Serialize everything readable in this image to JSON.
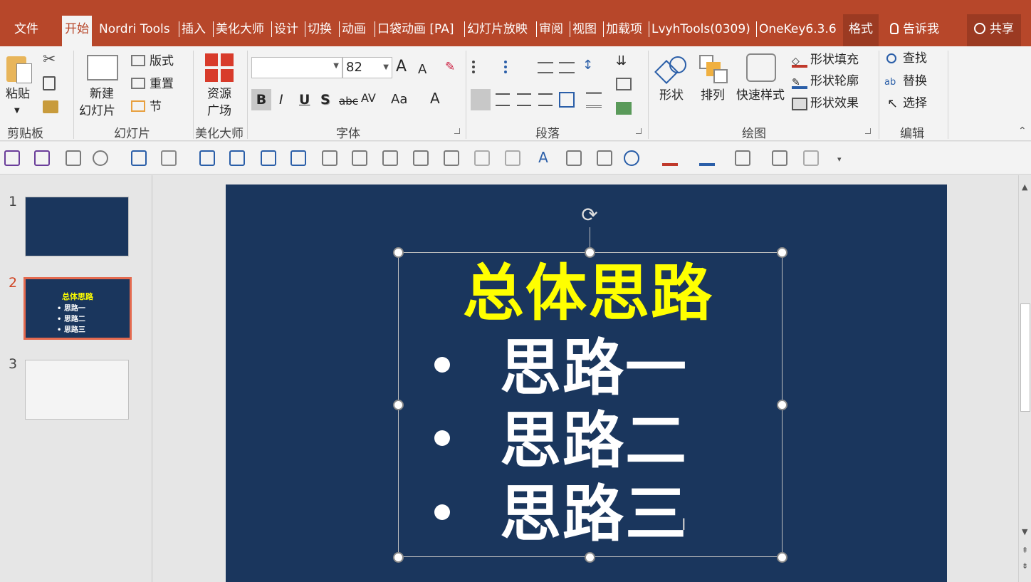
{
  "tabs": {
    "file": "文件",
    "home": "开始",
    "nordri": "Nordri Tools",
    "insert": "插入",
    "beautify": "美化大师",
    "design": "设计",
    "transitions": "切换",
    "animations": "动画",
    "pocket": "口袋动画 [PA]",
    "slideshow": "幻灯片放映",
    "review": "审阅",
    "view": "视图",
    "addins": "加载项",
    "lvyh": "LvyhTools(0309)",
    "onekey": "OneKey6.3.6",
    "format": "格式",
    "tellme": "告诉我",
    "share": "共享"
  },
  "ribbon": {
    "clipboard": {
      "paste": "粘贴",
      "label": "剪贴板"
    },
    "slides": {
      "new_slide_1": "新建",
      "new_slide_2": "幻灯片",
      "layout": "版式",
      "reset": "重置",
      "section": "节",
      "label": "幻灯片"
    },
    "beautify": {
      "res_1": "资源",
      "res_2": "广场",
      "label": "美化大师"
    },
    "font": {
      "font_size": "82",
      "bold": "B",
      "italic": "I",
      "underline": "U",
      "shadow": "S",
      "strike": "abc",
      "spacing": "AV",
      "case": "Aa",
      "color": "A",
      "grow": "A",
      "shrink": "A",
      "label": "字体"
    },
    "paragraph": {
      "label": "段落"
    },
    "drawing": {
      "shapes": "形状",
      "arrange": "排列",
      "quick_styles": "快速样式",
      "fill": "形状填充",
      "outline": "形状轮廓",
      "effects": "形状效果",
      "label": "绘图"
    },
    "editing": {
      "find": "查找",
      "replace": "替换",
      "select": "选择",
      "label": "编辑"
    }
  },
  "slides_panel": {
    "num1": "1",
    "num2": "2",
    "num3": "3",
    "thumb2_title": "总体思路",
    "thumb2_items": [
      "思路一",
      "思路二",
      "思路三"
    ]
  },
  "slide": {
    "title": "总体思路",
    "items": [
      "思路一",
      "思路二",
      "思路三"
    ],
    "title_color": "#ffff00",
    "bg_color": "#1a365d"
  }
}
